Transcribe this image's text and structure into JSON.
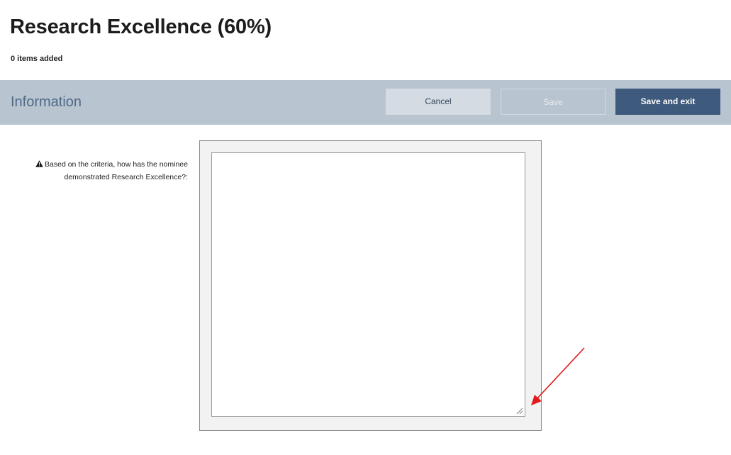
{
  "header": {
    "title": "Research Excellence (60%)",
    "items_count": "0 items added"
  },
  "toolbar": {
    "section_title": "Information",
    "cancel_label": "Cancel",
    "save_label": "Save",
    "save_exit_label": "Save and exit"
  },
  "form": {
    "question_label": "Based on the criteria, how has the nominee demonstrated Research Excellence?:",
    "answer_value": "",
    "required_icon": "warning-triangle-icon"
  },
  "annotation": {
    "icon": "red-arrow",
    "color": "#e11b1b"
  },
  "colors": {
    "info_bar": "#b9c4d1",
    "primary_button": "#3e5a7c",
    "secondary_button": "#d4dbe3"
  }
}
